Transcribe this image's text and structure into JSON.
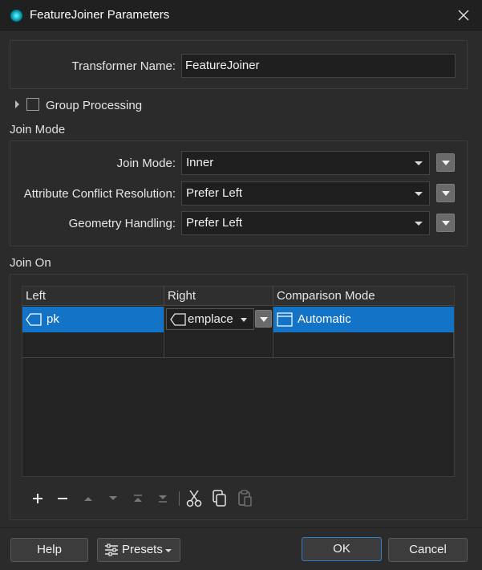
{
  "window": {
    "title": "FeatureJoiner Parameters"
  },
  "transformer": {
    "label": "Transformer Name:",
    "value": "FeatureJoiner"
  },
  "group_processing": {
    "label": "Group Processing",
    "checked": false
  },
  "join_mode_section": {
    "title": "Join Mode",
    "fields": [
      {
        "label": "Join Mode:",
        "value": "Inner"
      },
      {
        "label": "Attribute Conflict Resolution:",
        "value": "Prefer Left"
      },
      {
        "label": "Geometry Handling:",
        "value": "Prefer Left"
      }
    ]
  },
  "join_on_section": {
    "title": "Join On",
    "columns": [
      "Left",
      "Right",
      "Comparison Mode"
    ],
    "rows": [
      {
        "left": "pk",
        "right": "emplace",
        "mode": "Automatic"
      }
    ]
  },
  "toolbar": {
    "icons": [
      "add-icon",
      "remove-icon",
      "move-up-icon",
      "move-down-icon",
      "move-top-icon",
      "move-bottom-icon",
      "cut-icon",
      "copy-icon",
      "paste-icon"
    ]
  },
  "buttons": {
    "help": "Help",
    "presets": "Presets",
    "ok": "OK",
    "cancel": "Cancel"
  },
  "colors": {
    "selection": "#1373c7",
    "background": "#2b2b2b",
    "ok_border": "#2f7fcf"
  }
}
